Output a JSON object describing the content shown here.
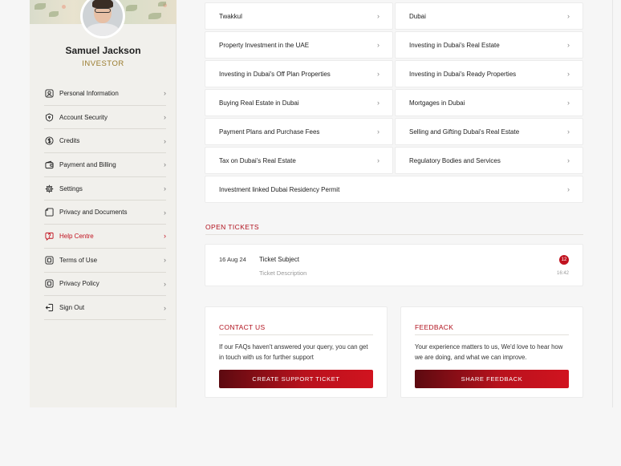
{
  "profile": {
    "name": "Samuel Jackson",
    "role": "INVESTOR"
  },
  "menu": [
    {
      "label": "Personal Information",
      "icon": "user-icon"
    },
    {
      "label": "Account Security",
      "icon": "shield-icon"
    },
    {
      "label": "Credits",
      "icon": "dollar-icon"
    },
    {
      "label": "Payment and Billing",
      "icon": "wallet-icon"
    },
    {
      "label": "Settings",
      "icon": "gear-icon"
    },
    {
      "label": "Privacy and Documents",
      "icon": "document-icon"
    },
    {
      "label": "Help Centre",
      "icon": "help-icon",
      "active": true
    },
    {
      "label": "Terms of Use",
      "icon": "terms-icon"
    },
    {
      "label": "Privacy Policy",
      "icon": "policy-icon"
    },
    {
      "label": "Sign Out",
      "icon": "sign-out-icon"
    }
  ],
  "faqs": [
    "Twakkul",
    "Dubai",
    "Property Investment in the UAE",
    "Investing in Dubai's Real Estate",
    "Investing in Dubai's Off Plan Properties",
    "Investing in Dubai's Ready Properties",
    "Buying Real Estate in Dubai",
    "Mortgages in Dubai",
    "Payment Plans and Purchase Fees",
    "Selling and Gifting Dubai's Real Estate",
    "Tax on Dubai's Real Estate",
    "Regulatory Bodies and Services",
    "Investment linked Dubai Residency Permit"
  ],
  "tickets": {
    "title": "OPEN TICKETS",
    "items": [
      {
        "date": "16 Aug 24",
        "subject": "Ticket Subject",
        "description": "Ticket Description",
        "badge": "12",
        "time": "16:42"
      }
    ]
  },
  "contact": {
    "title": "CONTACT US",
    "text": "If our FAQs haven't answered your query, you can get in touch with us for further support",
    "button": "CREATE SUPPORT TICKET"
  },
  "feedback": {
    "title": "FEEDBACK",
    "text": "Your experience matters to us, We'd love to hear how we are doing, and what we can improve.",
    "button": "SHARE FEEDBACK"
  },
  "colors": {
    "accent": "#c1121f",
    "gold": "#9a7b2d"
  }
}
